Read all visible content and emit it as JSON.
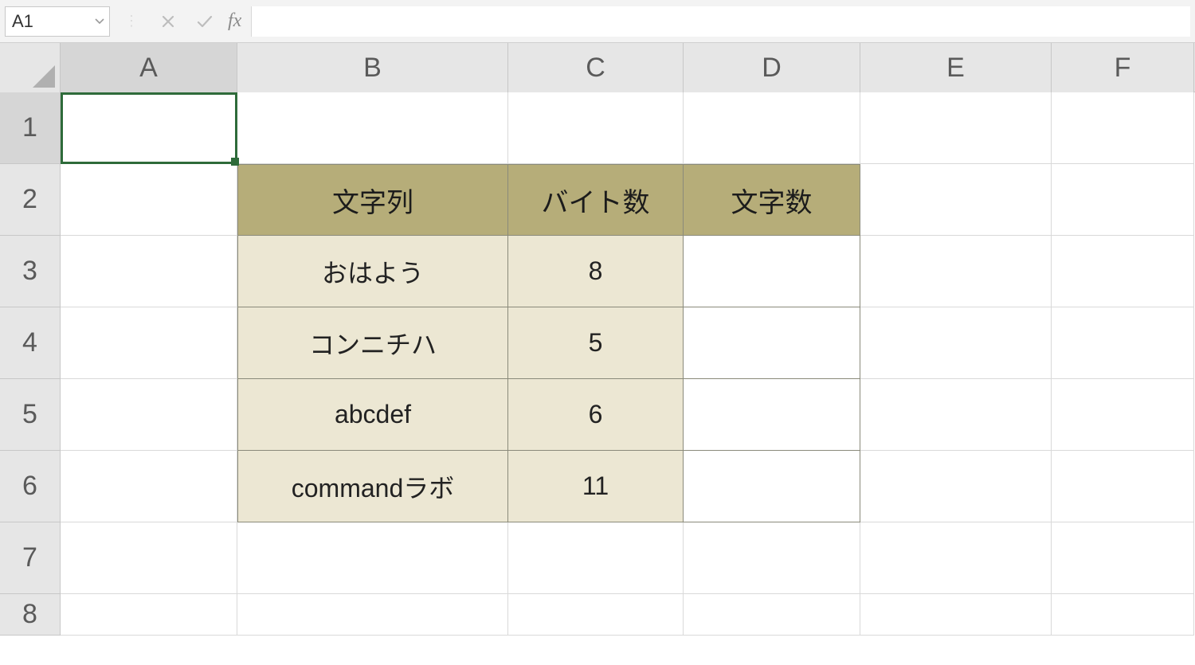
{
  "formula_bar": {
    "name_box": "A1",
    "formula_value": "",
    "fx_label": "fx"
  },
  "columns": [
    "A",
    "B",
    "C",
    "D",
    "E",
    "F"
  ],
  "rows": [
    "1",
    "2",
    "3",
    "4",
    "5",
    "6",
    "7",
    "8"
  ],
  "active_cell": "A1",
  "table": {
    "header": {
      "col_b": "文字列",
      "col_c": "バイト数",
      "col_d": "文字数"
    },
    "rows": [
      {
        "b": "おはよう",
        "c": "8",
        "d": ""
      },
      {
        "b": "コンニチハ",
        "c": "5",
        "d": ""
      },
      {
        "b": "abcdef",
        "c": "6",
        "d": ""
      },
      {
        "b": "commandラボ",
        "c": "11",
        "d": ""
      }
    ]
  },
  "colors": {
    "header_fill": "#b6ad79",
    "body_fill": "#ece7d3",
    "selection": "#2e6b3a"
  }
}
